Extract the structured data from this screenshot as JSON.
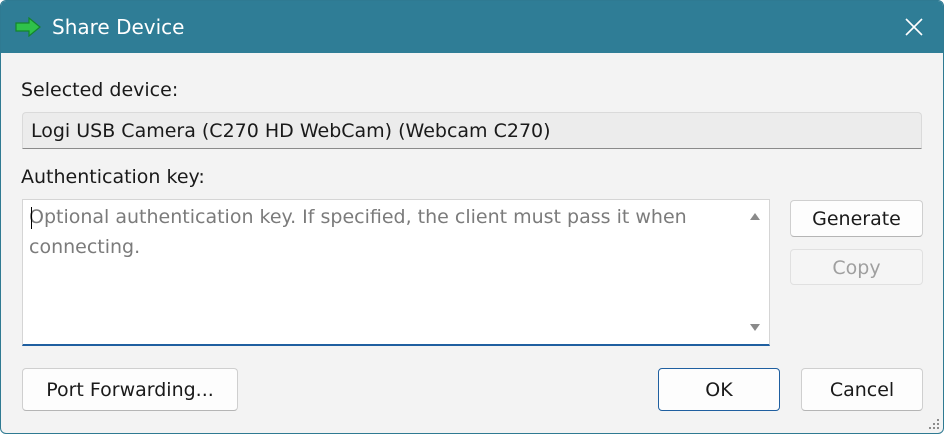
{
  "window": {
    "title": "Share Device",
    "title_icon": "green-arrow-icon",
    "close_icon": "close-icon"
  },
  "selected_device": {
    "label": "Selected device:",
    "value": "Logi USB Camera (C270 HD WebCam) (Webcam C270)"
  },
  "auth_key": {
    "label": "Authentication key:",
    "value": "",
    "placeholder": "Optional authentication key. If specified, the client must pass it when connecting."
  },
  "buttons": {
    "generate": "Generate",
    "copy": "Copy",
    "port_forwarding": "Port Forwarding...",
    "ok": "OK",
    "cancel": "Cancel"
  },
  "colors": {
    "titlebar": "#2f7d96",
    "accent": "#1f5fa0",
    "arrow": "#2fc24a"
  }
}
